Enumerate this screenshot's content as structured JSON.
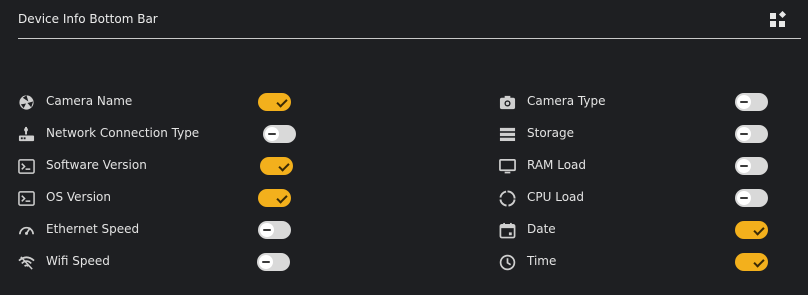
{
  "header": {
    "title": "Device Info Bottom Bar",
    "grid_icon": "grid-icon"
  },
  "left_items": [
    {
      "label": "Camera Name",
      "icon": "camera-aperture-icon",
      "enabled": true
    },
    {
      "label": "Network Connection Type",
      "icon": "network-icon",
      "enabled": false
    },
    {
      "label": "Software Version",
      "icon": "terminal-icon",
      "enabled": true
    },
    {
      "label": "OS Version",
      "icon": "terminal-icon",
      "enabled": true
    },
    {
      "label": "Ethernet Speed",
      "icon": "speedometer-icon",
      "enabled": false
    },
    {
      "label": "Wifi Speed",
      "icon": "wifi-icon",
      "enabled": false
    }
  ],
  "right_items": [
    {
      "label": "Camera Type",
      "icon": "camera-icon",
      "enabled": false
    },
    {
      "label": "Storage",
      "icon": "storage-icon",
      "enabled": false
    },
    {
      "label": "RAM Load",
      "icon": "monitor-icon",
      "enabled": false
    },
    {
      "label": "CPU Load",
      "icon": "progress-icon",
      "enabled": false
    },
    {
      "label": "Date",
      "icon": "calendar-icon",
      "enabled": true
    },
    {
      "label": "Time",
      "icon": "clock-icon",
      "enabled": true
    }
  ],
  "colors": {
    "background": "#1e1f22",
    "toggle_on": "#f3b01c",
    "toggle_off": "#d9d9d9",
    "icon": "#cfcfcf"
  }
}
